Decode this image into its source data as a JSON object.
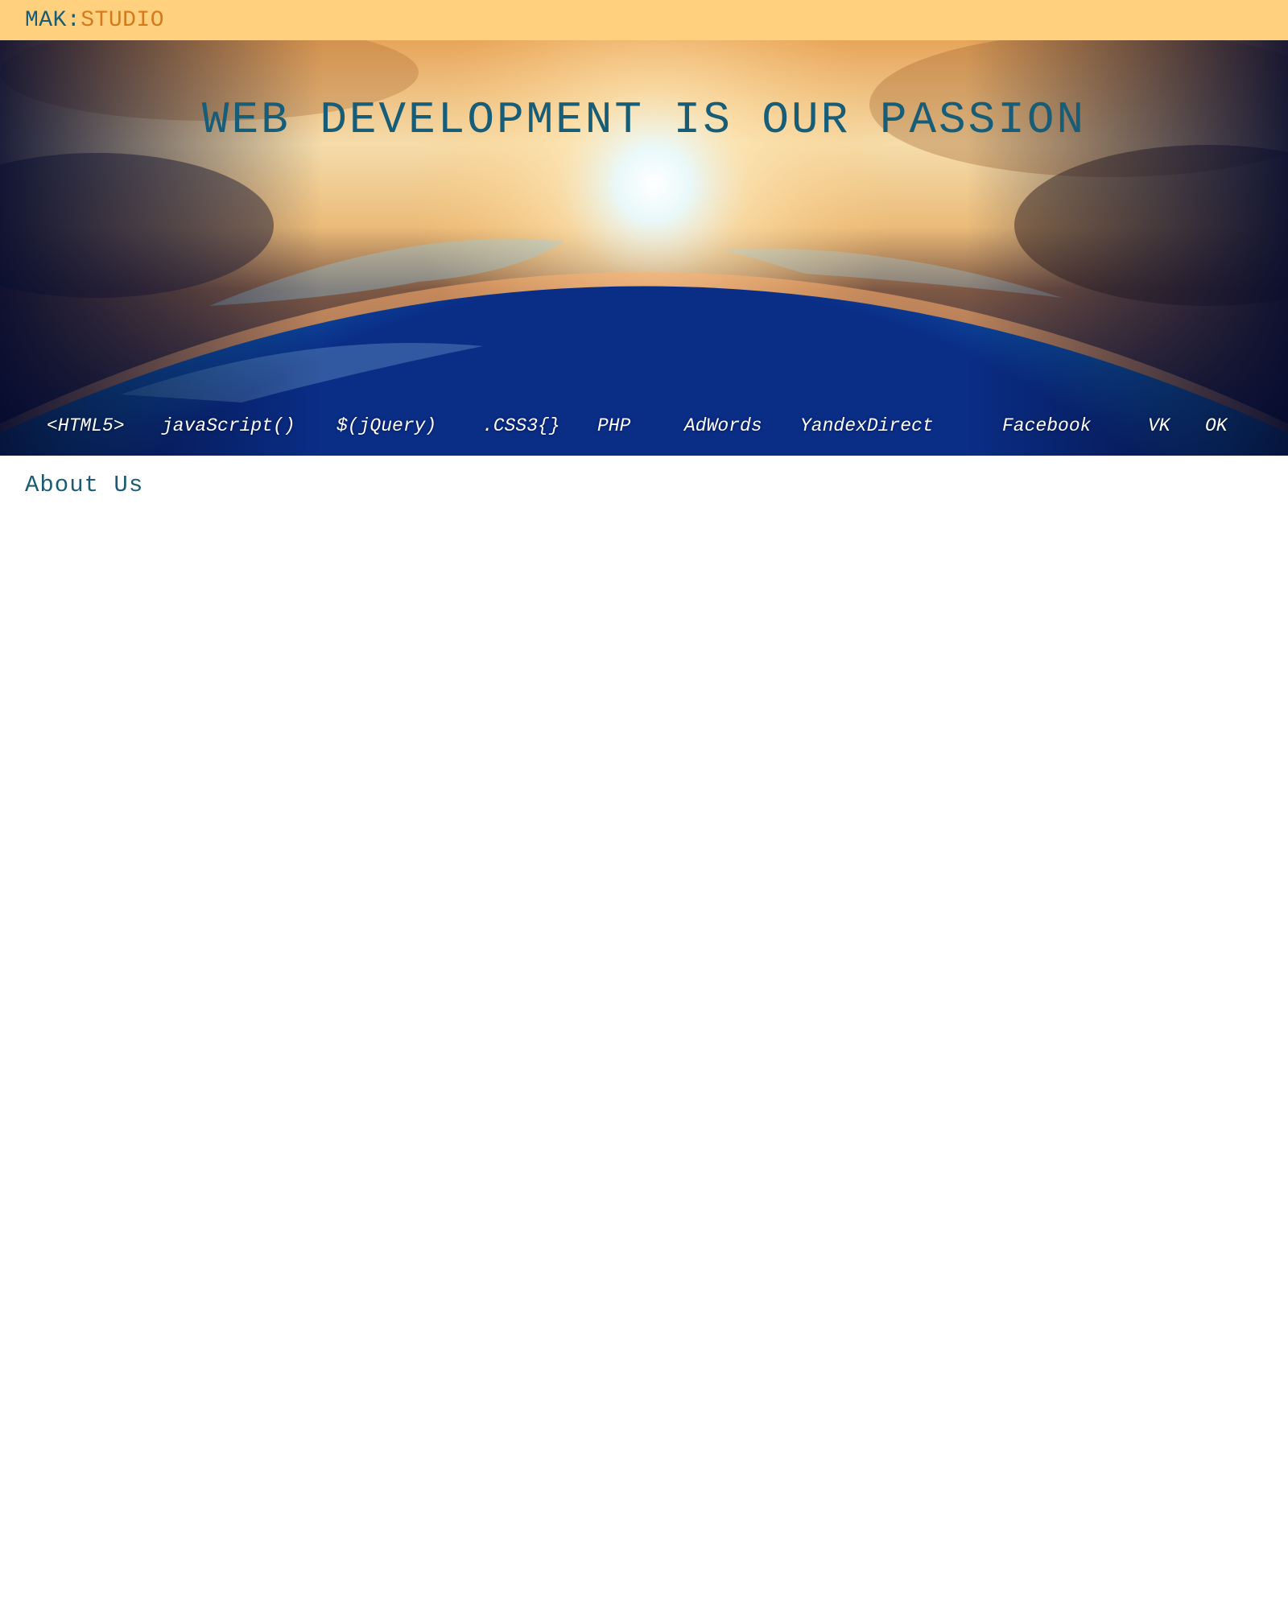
{
  "header": {
    "logo_part1": "MAK:",
    "logo_part2": "STUDIO"
  },
  "hero": {
    "headline": "WEB DEVELOPMENT IS OUR PASSION",
    "nav": [
      "<HTML5>",
      "javaScript()",
      "$(jQuery)",
      ".CSS3{}",
      "PHP",
      "AdWords",
      "YandexDirect",
      "Facebook",
      "VK",
      "OK"
    ]
  },
  "main": {
    "section_title": "About Us"
  },
  "colors": {
    "topbar": "#ffd17f",
    "brand_blue": "#1c5c73",
    "brand_orange": "#d57a1c",
    "nav_text": "#ffffff"
  }
}
